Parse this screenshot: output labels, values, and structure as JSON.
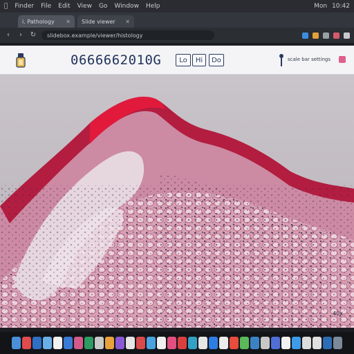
{
  "menubar": {
    "app_name": "Finder",
    "items": [
      "File",
      "Edit",
      "View",
      "Go",
      "Window",
      "Help"
    ],
    "status": [
      "Mon",
      "10:42"
    ]
  },
  "browser": {
    "tabs": [
      {
        "label": "i. Pathology"
      },
      {
        "label": "Slide viewer"
      }
    ],
    "url": "slidebox.example/viewer/histology"
  },
  "viewer": {
    "slide_id": "0666662010G",
    "buttons": [
      "Lo",
      "Hi",
      "Do"
    ],
    "scale_text": "scale bar settings",
    "magnification": "40x"
  },
  "colors": {
    "accent": "#22335c",
    "tissue": "#c8496f",
    "swatch": "#e05f8a"
  },
  "icons": [
    "home-icon",
    "pin-icon",
    "reload-icon",
    "back-icon",
    "forward-icon"
  ]
}
